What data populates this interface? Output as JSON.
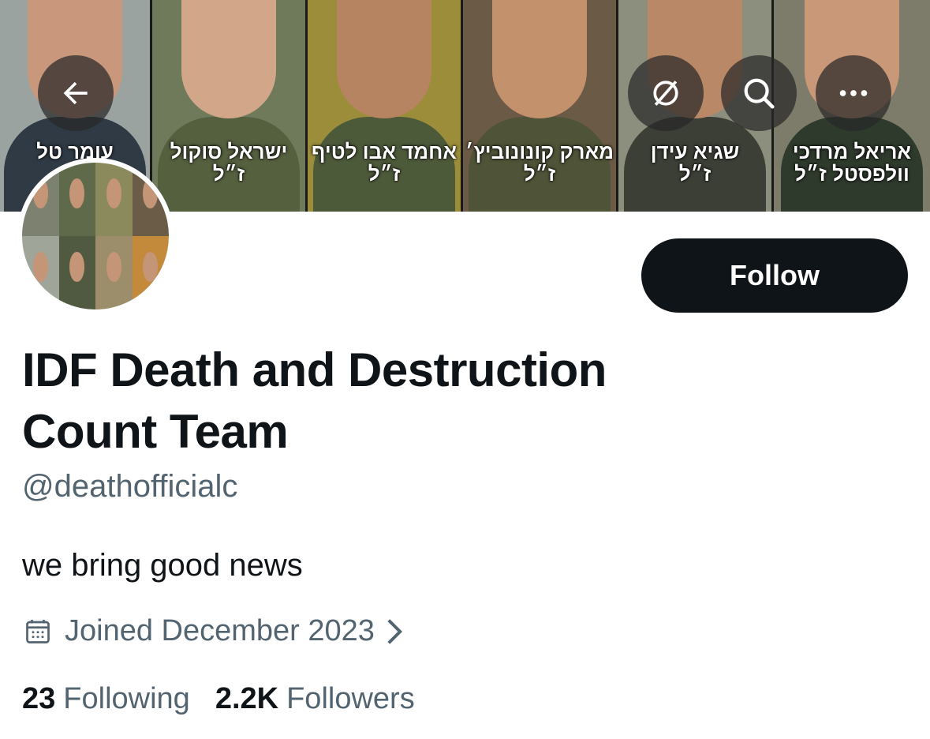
{
  "banner": {
    "panels": [
      {
        "caption": "עומר טל",
        "bg": "#9aa3a0",
        "skin": "#c9987c",
        "shirt": "#2f3a45"
      },
      {
        "caption": "ישראל סוקול\nז״ל",
        "bg": "#6f7a5b",
        "skin": "#d2a688",
        "shirt": "#55603f"
      },
      {
        "caption": "אחמד אבו לטיף\nז״ל",
        "bg": "#9b8d3a",
        "skin": "#b78461",
        "shirt": "#4d5a3a"
      },
      {
        "caption": "מארק קונונוביץ׳\nז״ל",
        "bg": "#6b5a45",
        "skin": "#c4916d",
        "shirt": "#4f5438"
      },
      {
        "caption": "שגיא עידן\nז״ל",
        "bg": "#8c8f7e",
        "skin": "#b98866",
        "shirt": "#3c3f36"
      },
      {
        "caption": "אריאל מרדכי\nוולפסטל ז״ל",
        "bg": "#7d7c6a",
        "skin": "#c99878",
        "shirt": "#2e3a2c"
      }
    ]
  },
  "nav": {
    "back_icon": "arrow-left-icon",
    "grok_icon": "slashed-circle-icon",
    "search_icon": "search-icon",
    "more_icon": "more-horizontal-icon"
  },
  "profile": {
    "name": "IDF Death and Destruction Count Team",
    "handle": "@deathofficialc",
    "bio": "we bring good news",
    "joined": "Joined December 2023",
    "follow_label": "Follow",
    "following_count": "23",
    "following_label": "Following",
    "followers_count": "2.2K",
    "followers_label": "Followers"
  },
  "colors": {
    "text_primary": "#0f1419",
    "text_secondary": "#536471",
    "button_bg": "#0f1419",
    "button_text": "#ffffff"
  }
}
